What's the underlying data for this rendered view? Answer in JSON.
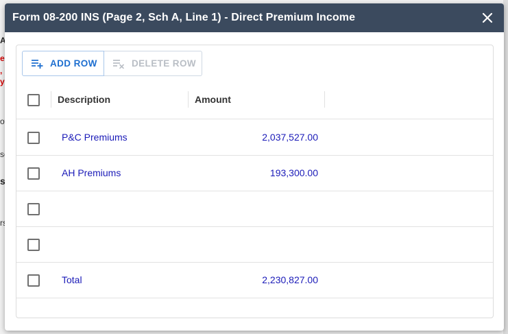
{
  "background": {
    "snippets": [
      "A",
      "es",
      ",",
      "y",
      "of",
      "se",
      "s",
      "rs"
    ]
  },
  "dialog": {
    "title": "Form 08-200 INS (Page 2, Sch A, Line 1) - Direct Premium Income"
  },
  "toolbar": {
    "add_row_label": "ADD ROW",
    "delete_row_label": "DELETE ROW"
  },
  "grid": {
    "columns": [
      "Description",
      "Amount"
    ],
    "rows": [
      {
        "description": "P&C Premiums",
        "amount": "2,037,527.00"
      },
      {
        "description": "AH Premiums",
        "amount": "193,300.00"
      },
      {
        "description": "",
        "amount": ""
      },
      {
        "description": "",
        "amount": ""
      },
      {
        "description": "Total",
        "amount": "2,230,827.00"
      }
    ]
  },
  "colors": {
    "header_bg": "#3b4a5e",
    "accent": "#1e6fd0",
    "value_text": "#1a1ab8",
    "disabled": "#b9bec5"
  }
}
